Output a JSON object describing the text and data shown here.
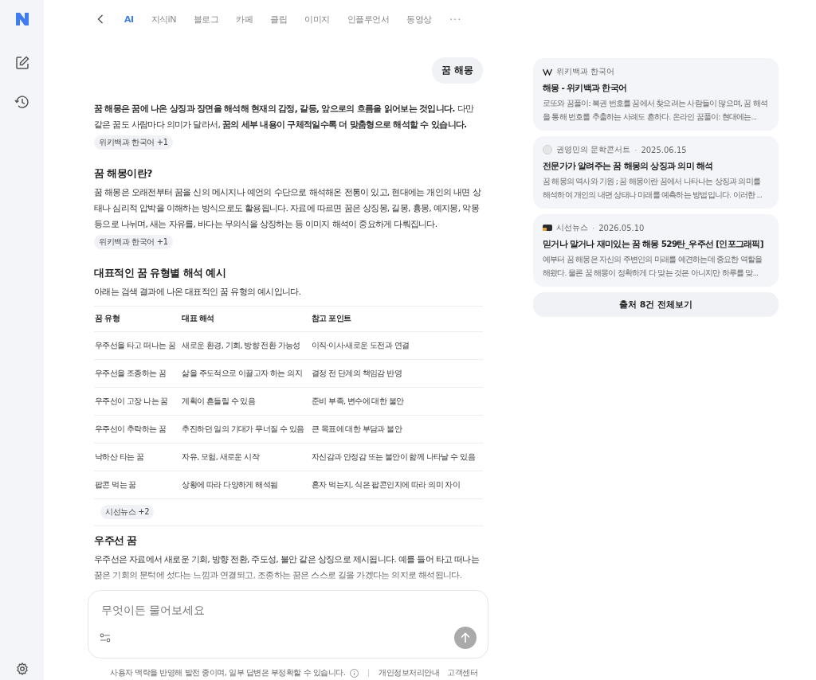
{
  "tabs": [
    {
      "label": "AI",
      "selected": true
    },
    {
      "label": "지식iN",
      "selected": false
    },
    {
      "label": "블로그",
      "selected": false
    },
    {
      "label": "카페",
      "selected": false
    },
    {
      "label": "클립",
      "selected": false
    },
    {
      "label": "이미지",
      "selected": false
    },
    {
      "label": "인플루언서",
      "selected": false
    },
    {
      "label": "동영상",
      "selected": false
    }
  ],
  "more": "···",
  "query": "꿈 해몽",
  "intro": {
    "text": "**꿈 해몽은 꿈에 나온 상징과 장면을 해석해 현재의 감정, 갈등, 앞으로의 흐름을 읽어보는 것입니다.** 다만 같은 꿈도 사람마다 의미가 달라서, **꿈의 세부 내용이 구체적일수록 더 맞춤형으로 해석할 수 있습니다.**",
    "source": "위키백과 한국어 +1"
  },
  "section1": {
    "heading": "꿈 해몽이란?",
    "text": "꿈 해몽은 오래전부터 꿈을 신의 메시지나 예언의 수단으로 해석해온 전통이 있고, 현대에는 개인의 내면 상태나 심리적 압박을 이해하는 방식으로도 활용됩니다. 자료에 따르면 꿈은 상징몽, 길몽, 흉몽, 예지몽, 악몽 등으로 나뉘며, 새는 자유를, 바다는 무의식을 상징하는 등 이미지 해석이 중요하게 다뤄집니다.",
    "source": "위키백과 한국어 +1"
  },
  "section2": {
    "heading": "대표적인 꿈 유형별 해석 예시",
    "text": "아래는 검색 결과에 나온 대표적인 꿈 유형의 예시입니다.",
    "table": {
      "columns": [
        "꿈 유형",
        "대표 해석",
        "참고 포인트"
      ],
      "rows": [
        [
          "우주선을 타고 떠나는 꿈",
          "새로운 환경, 기회, 방향 전환 가능성",
          "이직·이사·새로운 도전과 연결"
        ],
        [
          "우주선을 조종하는 꿈",
          "삶을 주도적으로 이끌고자 하는 의지",
          "결정 전 단계의 책임감 반영"
        ],
        [
          "우주선이 고장 나는 꿈",
          "계획이 흔들릴 수 있음",
          "준비 부족, 변수에 대한 불안"
        ],
        [
          "우주선이 추락하는 꿈",
          "추진하던 일의 기대가 무너질 수 있음",
          "큰 목표에 대한 부담과 불안"
        ],
        [
          "낙하산 타는 꿈",
          "자유, 모험, 새로운 시작",
          "자신감과 안정감 또는 불안이 함께 나타날 수 있음"
        ],
        [
          "팝콘 먹는 꿈",
          "상황에 따라 다양하게 해석됨",
          "혼자 먹는지, 식은 팝콘인지에 따라 의미 차이"
        ]
      ]
    },
    "source": "시선뉴스 +2"
  },
  "section3": {
    "heading": "우주선 꿈",
    "text": "우주선은 자료에서 새로운 기회, 방향 전환, 주도성, 불안 같은 상징으로 제시됩니다. 예를 들어 타고 떠나는 꿈은 기회의 문턱에 섰다는 느낌과 연결되고, 조종하는 꿈은 스스로 길을 가겠다는 의지로 해석됩니다."
  },
  "input": {
    "placeholder": "무엇이든 물어보세요"
  },
  "footer": {
    "notice": "사용자 맥락을 반영해 발전 중이며, 일부 답변은 부정확할 수 있습니다.",
    "links": [
      "개인정보처리안내",
      "고객센터"
    ]
  },
  "sources": [
    {
      "kind": "wiki",
      "site": "위키백과 한국어",
      "title": "해몽 - 위키백과 한국어",
      "snippet": "로또와 꿈풀이: 복권 번호를 꿈에서 찾으려는 사람들이 많으며, 꿈 해석을 통해 번호를 추출하는 사례도 흔하다. 온라인 꿈풀이: 현대에는..."
    },
    {
      "kind": "blog",
      "site": "권영민의 문학콘서트",
      "date": "2025.06.15",
      "title": "전문가가 알려주는 꿈 해몽의 상징과 의미 해석",
      "snippet": "꿈 해몽의 역사와 기원 ; 꿈 해몽이란 꿈에서 나타나는 상징과 의미를 해석하여 개인의 내면 상태나 미래를 예측하는 방법입니다. 이러한 ..."
    },
    {
      "kind": "news",
      "site": "시선뉴스",
      "date": "2026.05.10",
      "title": "믿거나 말거나 재미있는 꿈 해몽 529탄_우주선 [인포그래픽]",
      "snippet": "예부터 꿈 해몽은 자신의 주변인의 미래를 예견하는데 중요한 역할을 해왔다. 물론 꿈 해몽이 정확하게 다 맞는 것은 아니지만 하루를 맞..."
    }
  ],
  "all_sources": "출처 8건 전체보기",
  "date_separator": "·"
}
